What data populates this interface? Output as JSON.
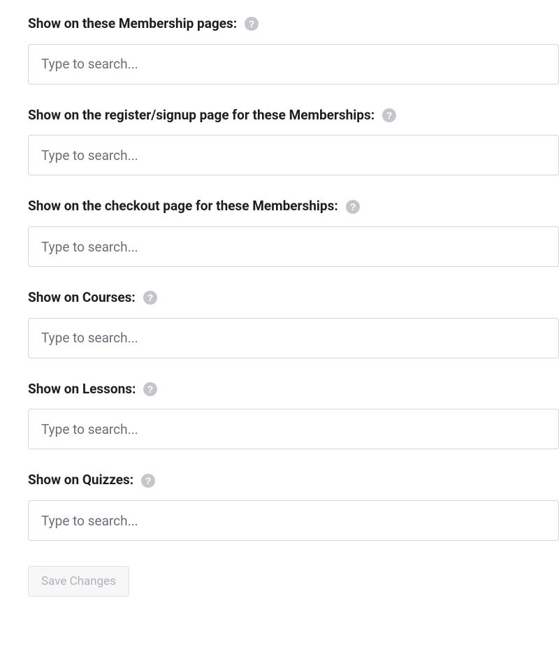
{
  "placeholders": {
    "search": "Type to search..."
  },
  "fields": {
    "membership_pages": {
      "label": "Show on these Membership pages:"
    },
    "membership_register": {
      "label": "Show on the register/signup page for these Memberships:"
    },
    "membership_checkout": {
      "label": "Show on the checkout page for these Memberships:"
    },
    "courses": {
      "label": "Show on Courses:"
    },
    "lessons": {
      "label": "Show on Lessons:"
    },
    "quizzes": {
      "label": "Show on Quizzes:"
    }
  },
  "buttons": {
    "save": "Save Changes"
  }
}
